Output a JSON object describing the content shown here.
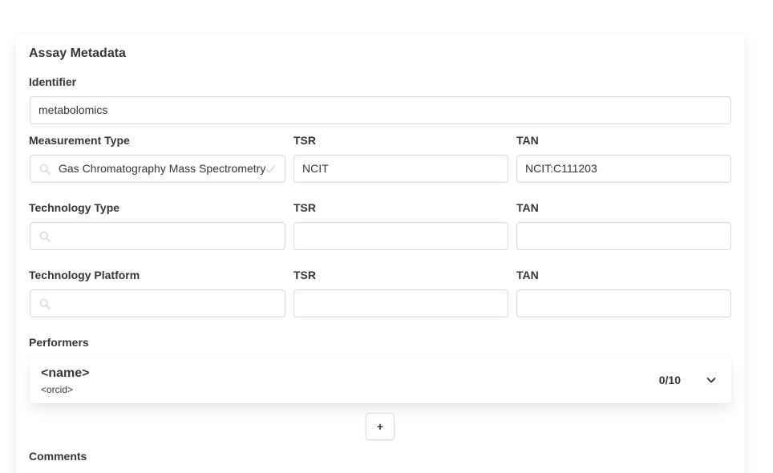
{
  "section": {
    "title": "Assay Metadata"
  },
  "identifier": {
    "label": "Identifier",
    "value": "metabolomics"
  },
  "measurement": {
    "label": "Measurement Type",
    "value": "Gas Chromatography Mass Spectrometry",
    "tsr_label": "TSR",
    "tsr_value": "NCIT",
    "tan_label": "TAN",
    "tan_value": "NCIT:C111203"
  },
  "technology_type": {
    "label": "Technology Type",
    "value": "",
    "tsr_label": "TSR",
    "tsr_value": "",
    "tan_label": "TAN",
    "tan_value": ""
  },
  "technology_platform": {
    "label": "Technology Platform",
    "value": "",
    "tsr_label": "TSR",
    "tsr_value": "",
    "tan_label": "TAN",
    "tan_value": ""
  },
  "performers": {
    "label": "Performers",
    "items": [
      {
        "name": "<name>",
        "orcid": "<orcid>",
        "count": "0/10"
      }
    ],
    "add_label": "+"
  },
  "comments": {
    "label": "Comments"
  },
  "icons": {
    "search": "search-icon",
    "check": "check-icon",
    "chevron": "chevron-down-icon"
  },
  "colors": {
    "icon_muted": "#dbdbdb",
    "text": "#363636",
    "border": "#dbdbdb"
  }
}
